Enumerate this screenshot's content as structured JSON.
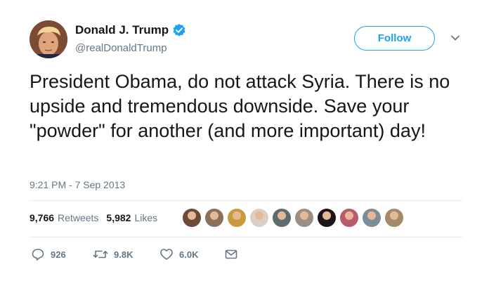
{
  "author": {
    "display_name": "Donald J. Trump",
    "handle": "@realDonaldTrump",
    "verified": true,
    "avatar_icon": "profile-photo"
  },
  "follow_label": "Follow",
  "tweet": {
    "text": "President Obama, do not attack Syria. There is no upside and tremendous downside. Save your \"powder\" for another (and more important) day!",
    "timestamp": "9:21 PM - 7 Sep 2013"
  },
  "stats": {
    "retweets_count": "9,766",
    "retweets_label": "Retweets",
    "likes_count": "5,982",
    "likes_label": "Likes"
  },
  "liker_avatars": [
    {
      "name": "liker-1",
      "color": "#6b4a3a"
    },
    {
      "name": "liker-2",
      "color": "#8a6f5c"
    },
    {
      "name": "liker-3",
      "color": "#c89a3e"
    },
    {
      "name": "liker-4",
      "color": "#d9d0c8"
    },
    {
      "name": "liker-5",
      "color": "#5c6b6e"
    },
    {
      "name": "liker-6",
      "color": "#9a8f86"
    },
    {
      "name": "liker-7",
      "color": "#1c1418"
    },
    {
      "name": "liker-8",
      "color": "#b85b6b"
    },
    {
      "name": "liker-9",
      "color": "#7a8d9a"
    },
    {
      "name": "liker-10",
      "color": "#a58a6a"
    }
  ],
  "actions": {
    "reply_count": "926",
    "retweet_count": "9.8K",
    "like_count": "6.0K"
  },
  "colors": {
    "accent": "#1da1f2",
    "text": "#14171a",
    "secondary": "#657786",
    "divider": "#e6ecf0"
  }
}
